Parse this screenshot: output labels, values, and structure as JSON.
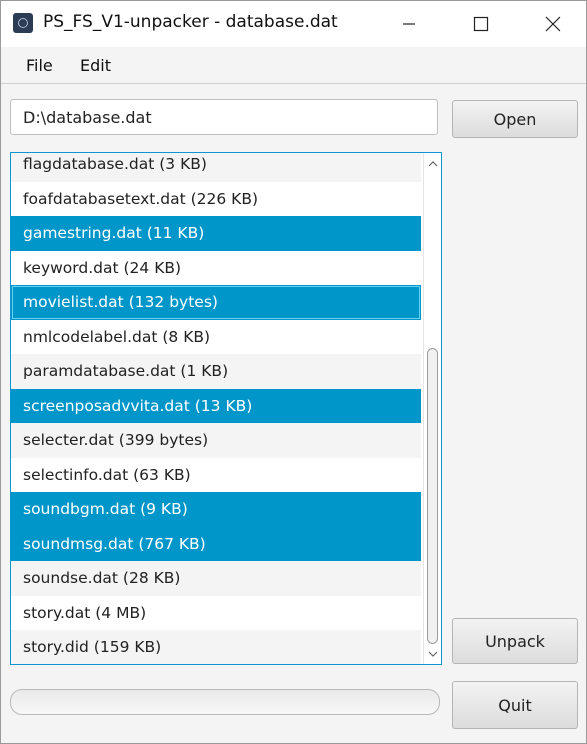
{
  "window": {
    "title": "PS_FS_V1-unpacker - database.dat"
  },
  "menu": {
    "items": [
      {
        "label": "File"
      },
      {
        "label": "Edit"
      }
    ]
  },
  "path": {
    "value": "D:\\database.dat"
  },
  "buttons": {
    "open": "Open",
    "unpack": "Unpack",
    "quit": "Quit"
  },
  "files": [
    {
      "label": "flagdatabase.dat (3 KB)",
      "selected": false
    },
    {
      "label": "foafdatabasetext.dat (226 KB)",
      "selected": false
    },
    {
      "label": "gamestring.dat (11 KB)",
      "selected": true
    },
    {
      "label": "keyword.dat (24 KB)",
      "selected": false
    },
    {
      "label": "movielist.dat (132 bytes)",
      "selected": true,
      "focused": true
    },
    {
      "label": "nmlcodelabel.dat (8 KB)",
      "selected": false
    },
    {
      "label": "paramdatabase.dat (1 KB)",
      "selected": false
    },
    {
      "label": "screenposadvvita.dat (13 KB)",
      "selected": true
    },
    {
      "label": "selecter.dat (399 bytes)",
      "selected": false
    },
    {
      "label": "selectinfo.dat (63 KB)",
      "selected": false
    },
    {
      "label": "soundbgm.dat (9 KB)",
      "selected": true
    },
    {
      "label": "soundmsg.dat (767 KB)",
      "selected": true
    },
    {
      "label": "soundse.dat (28 KB)",
      "selected": false
    },
    {
      "label": "story.dat (4 MB)",
      "selected": false
    },
    {
      "label": "story.did (159 KB)",
      "selected": false
    }
  ],
  "progress": {
    "value": 0
  },
  "colors": {
    "selection": "#0096c9",
    "focus_border": "#0b96d2"
  },
  "icons": {
    "app": "app-icon",
    "minimize": "minimize-icon",
    "maximize": "maximize-icon",
    "close": "close-icon",
    "scroll_up": "chevron-up-icon",
    "scroll_down": "chevron-down-icon"
  }
}
